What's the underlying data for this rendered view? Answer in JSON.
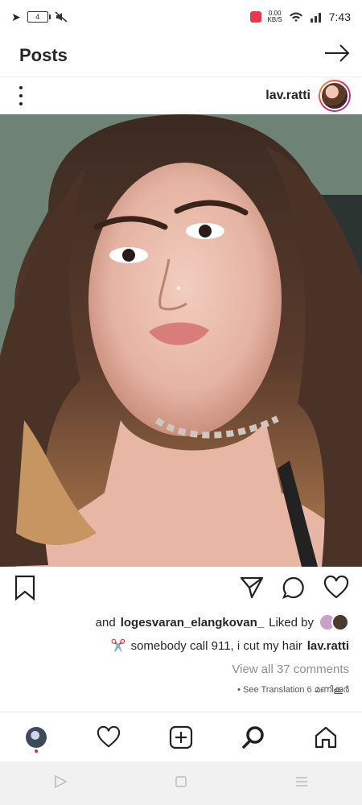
{
  "status_bar": {
    "time": "7:43",
    "battery": "4",
    "net_speed_value": "0.00",
    "net_speed_unit": "KB/S"
  },
  "header": {
    "title": "Posts"
  },
  "post": {
    "username": "lav.ratti",
    "likes": {
      "prefix": "Liked by",
      "user": "logesvaran_elangkovan_",
      "suffix": "and"
    },
    "caption": {
      "user": "lav.ratti",
      "text": "somebody call 911, i cut my hair",
      "emoji": "✂️"
    },
    "comments_link": "View all 37 comments",
    "time_ago": "6 മണിക്കൂർ",
    "see_translation": "• See Translation"
  },
  "colors": {
    "accent_red": "#e0245e",
    "text": "#262626",
    "muted": "#8e8e8e"
  },
  "icons": {
    "back": "arrow-icon",
    "bookmark": "bookmark-icon",
    "share": "send-icon",
    "comment": "comment-icon",
    "like": "heart-icon",
    "home": "home-icon",
    "search": "search-icon",
    "add": "add-post-icon",
    "activity": "heart-icon",
    "profile": "profile-avatar-icon"
  }
}
